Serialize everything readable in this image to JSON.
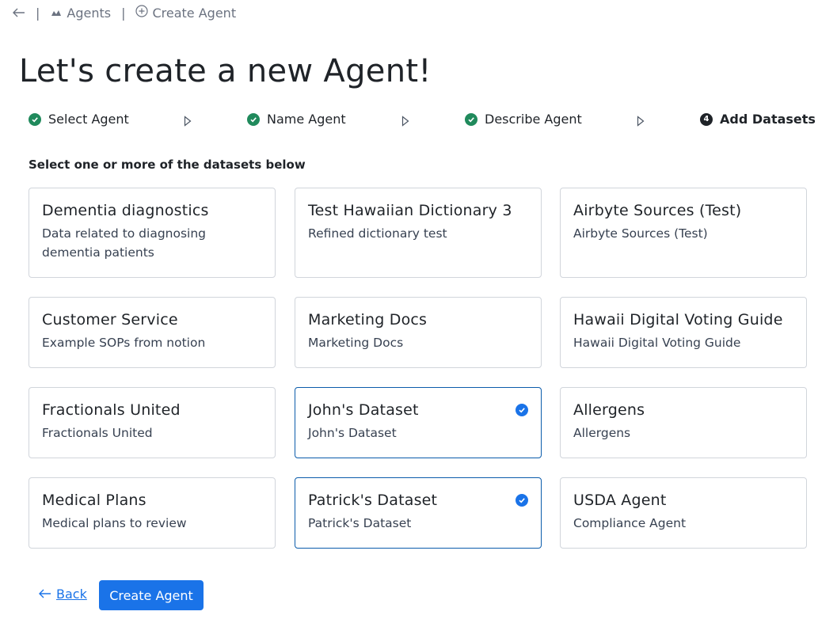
{
  "breadcrumb": {
    "back_icon": "arrow-left-icon",
    "items": [
      {
        "label": "Agents",
        "icon": "agent-icon"
      },
      {
        "label": "Create Agent",
        "icon": "plus-circle-icon"
      }
    ]
  },
  "page_title": "Let's create a new Agent!",
  "steps": [
    {
      "label": "Select Agent",
      "state": "complete"
    },
    {
      "label": "Name Agent",
      "state": "complete"
    },
    {
      "label": "Describe Agent",
      "state": "complete"
    },
    {
      "label": "Add Datasets",
      "state": "active",
      "number": "4"
    }
  ],
  "instructions": "Select one or more of the datasets below",
  "datasets": [
    {
      "title": "Dementia diagnostics",
      "description": "Data related to diagnosing dementia patients",
      "selected": false
    },
    {
      "title": "Test Hawaiian Dictionary 3",
      "description": "Refined dictionary test",
      "selected": false
    },
    {
      "title": "Airbyte Sources (Test)",
      "description": "Airbyte Sources (Test)",
      "selected": false
    },
    {
      "title": "Customer Service",
      "description": "Example SOPs from notion",
      "selected": false
    },
    {
      "title": "Marketing Docs",
      "description": "Marketing Docs",
      "selected": false
    },
    {
      "title": "Hawaii Digital Voting Guide",
      "description": "Hawaii Digital Voting Guide",
      "selected": false
    },
    {
      "title": "Fractionals United",
      "description": "Fractionals United",
      "selected": false
    },
    {
      "title": "John's Dataset",
      "description": "John's Dataset",
      "selected": true
    },
    {
      "title": "Allergens",
      "description": "Allergens",
      "selected": false
    },
    {
      "title": "Medical Plans",
      "description": "Medical plans to review",
      "selected": false
    },
    {
      "title": "Patrick's Dataset",
      "description": "Patrick's Dataset",
      "selected": true
    },
    {
      "title": "USDA Agent",
      "description": "Compliance Agent",
      "selected": false
    }
  ],
  "footer": {
    "back_label": "Back",
    "create_label": "Create Agent"
  },
  "colors": {
    "primary": "#1a73e8",
    "complete": "#208a5c",
    "selected_border": "#0b5cab",
    "card_border": "#d1d5db"
  }
}
